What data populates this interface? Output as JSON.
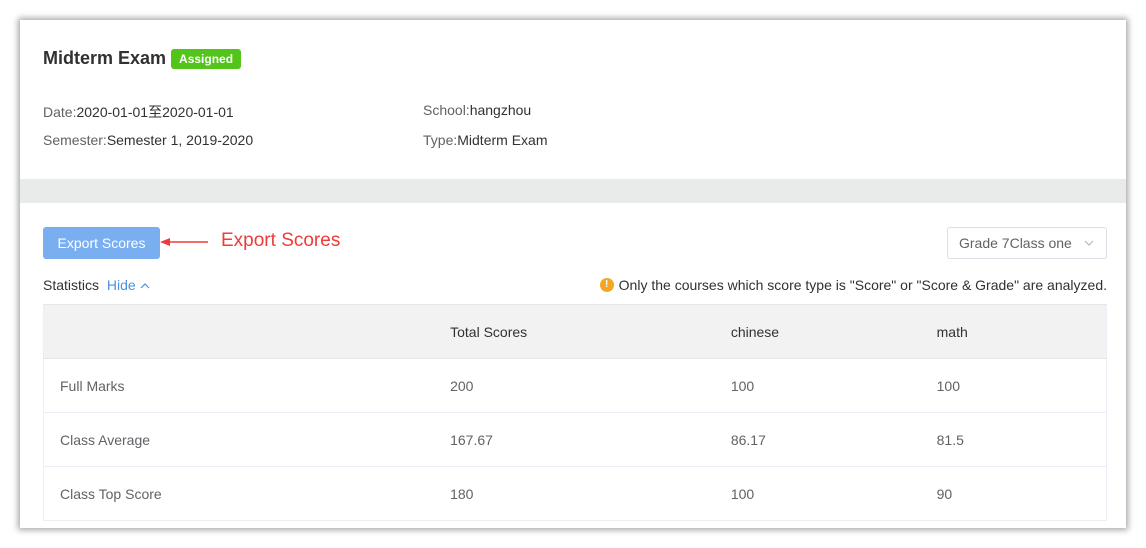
{
  "exam": {
    "title": "Midterm Exam",
    "status": "Assigned",
    "date_label": "Date:",
    "date_value": "2020-01-01至2020-01-01",
    "school_label": "School:",
    "school_value": "hangzhou",
    "semester_label": "Semester:",
    "semester_value": "Semester 1, 2019-2020",
    "type_label": "Type:",
    "type_value": "Midterm Exam"
  },
  "toolbar": {
    "export_label": "Export Scores",
    "annotation": "Export Scores",
    "class_select": "Grade 7Class one"
  },
  "statistics": {
    "label": "Statistics",
    "toggle": "Hide",
    "note": "Only the courses which score type is \"Score\" or \"Score & Grade\" are analyzed."
  },
  "table": {
    "headers": [
      "",
      "Total Scores",
      "chinese",
      "math"
    ],
    "rows": [
      [
        "Full Marks",
        "200",
        "100",
        "100"
      ],
      [
        "Class Average",
        "167.67",
        "86.17",
        "81.5"
      ],
      [
        "Class Top Score",
        "180",
        "100",
        "90"
      ]
    ]
  },
  "colors": {
    "badge": "#52c41a",
    "primary_button": "#79aef0",
    "annotation": "#ef3b3b",
    "link": "#4a90e2",
    "warning": "#f5a623"
  }
}
